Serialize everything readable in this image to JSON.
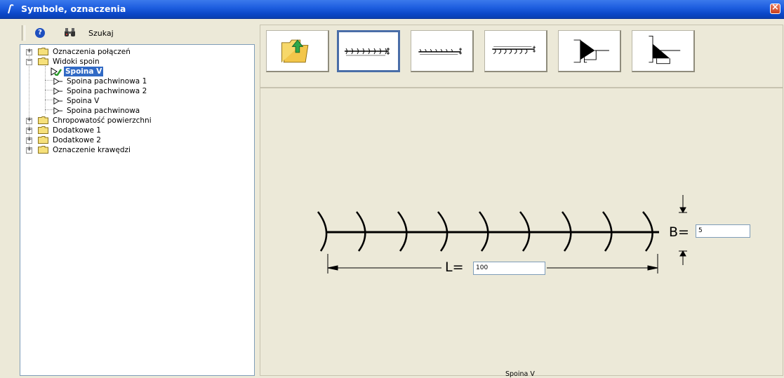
{
  "window": {
    "title": "Symbole, oznaczenia"
  },
  "toolbar": {
    "search_label": "Szukaj"
  },
  "tree": {
    "items": [
      {
        "label": "Oznaczenia połączeń",
        "expanded": false
      },
      {
        "label": "Widoki spoin",
        "expanded": true,
        "children": [
          {
            "label": "Spoina V",
            "selected": true
          },
          {
            "label": "Spoina pachwinowa 1"
          },
          {
            "label": "Spoina pachwinowa 2"
          },
          {
            "label": "Spoina V"
          },
          {
            "label": "Spoina pachwinowa"
          }
        ]
      },
      {
        "label": "Chropowatość powierzchni",
        "expanded": false
      },
      {
        "label": "Dodatkowe 1",
        "expanded": false
      },
      {
        "label": "Dodatkowe 2",
        "expanded": false
      },
      {
        "label": "Oznaczenie krawędzi",
        "expanded": false
      }
    ]
  },
  "preview": {
    "b_label": "B=",
    "b_value": "5",
    "l_label": "L=",
    "l_value": "100",
    "caption": "Spoina V"
  },
  "colors": {
    "title_bar": "#0B48C9",
    "selection": "#316AC5",
    "active_border": "#4a6ea8",
    "background": "#ECE9D8"
  }
}
